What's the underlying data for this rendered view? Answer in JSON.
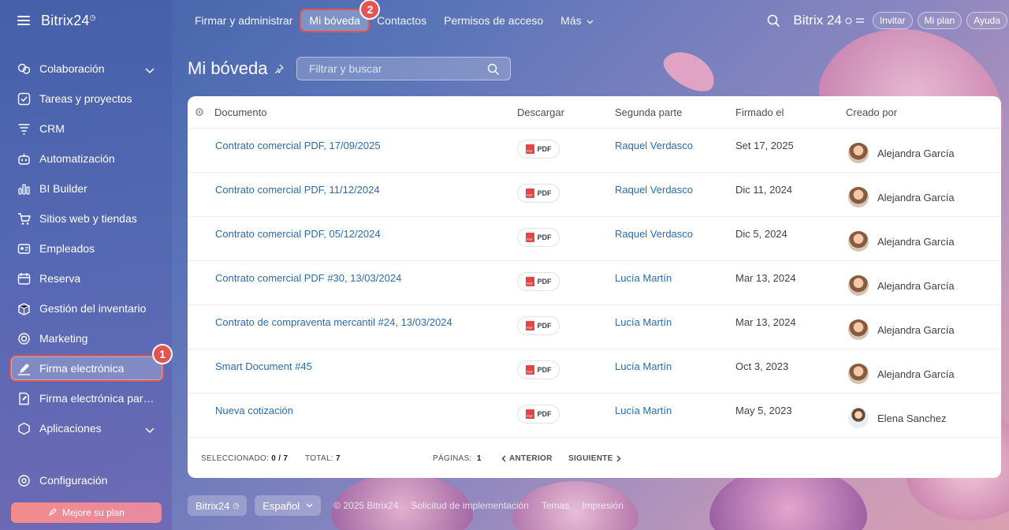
{
  "sidebar": {
    "brand": "Bitrix24",
    "items": [
      {
        "label": "Colaboración",
        "icon": "chat-bubbles-icon",
        "chevron": true
      },
      {
        "label": "Tareas y proyectos",
        "icon": "checkbox-icon"
      },
      {
        "label": "CRM",
        "icon": "funnel-icon"
      },
      {
        "label": "Automatización",
        "icon": "robot-icon"
      },
      {
        "label": "BI Builder",
        "icon": "bar-chart-icon"
      },
      {
        "label": "Sitios web y tiendas",
        "icon": "cart-icon"
      },
      {
        "label": "Empleados",
        "icon": "id-card-icon"
      },
      {
        "label": "Reserva",
        "icon": "calendar-icon"
      },
      {
        "label": "Gestión del inventario",
        "icon": "box-icon"
      },
      {
        "label": "Marketing",
        "icon": "target-icon"
      },
      {
        "label": "Firma electrónica",
        "icon": "pen-icon",
        "active": true,
        "badge": "1"
      },
      {
        "label": "Firma electrónica para RR.HH.",
        "icon": "pen-doc-icon"
      },
      {
        "label": "Aplicaciones",
        "icon": "grid-icon",
        "chevron": true
      }
    ],
    "config_label": "Configuración",
    "upgrade_label": "Mejore su plan"
  },
  "topnav": {
    "items": [
      "Firmar y administrar",
      "Mi bóveda",
      "Contactos",
      "Permisos de acceso",
      "Más"
    ],
    "active_badge": "2",
    "brand": "Bitrix 24",
    "pills": [
      "Invitar",
      "Mi plan",
      "Ayuda"
    ]
  },
  "page": {
    "title": "Mi bóveda",
    "search_placeholder": "Filtrar y buscar"
  },
  "table": {
    "headers": [
      "Documento",
      "Descargar",
      "Segunda parte",
      "Firmado el",
      "Creado por"
    ],
    "pdf_label": "PDF",
    "rows": [
      {
        "doc": "Contrato comercial PDF, 17/09/2025",
        "party": "Raquel Verdasco",
        "date": "Set 17, 2025",
        "author": "Alejandra García"
      },
      {
        "doc": "Contrato comercial PDF, 11/12/2024",
        "party": "Raquel Verdasco",
        "date": "Dic 11, 2024",
        "author": "Alejandra García"
      },
      {
        "doc": "Contrato comercial PDF, 05/12/2024",
        "party": "Raquel Verdasco",
        "date": "Dic 5, 2024",
        "author": "Alejandra García"
      },
      {
        "doc": "Contrato comercial PDF #30, 13/03/2024",
        "party": "Lucía Martín",
        "date": "Mar 13, 2024",
        "author": "Alejandra García"
      },
      {
        "doc": "Contrato de compraventa mercantil #24, 13/03/2024",
        "party": "Lucía Martín",
        "date": "Mar 13, 2024",
        "author": "Alejandra García"
      },
      {
        "doc": "Smart Document #45",
        "party": "Lucía Martín",
        "date": "Oct 3, 2023",
        "author": "Alejandra García"
      },
      {
        "doc": "Nueva cotización",
        "party": "Lucía Martín",
        "date": "May 5, 2023",
        "author": "Elena Sanchez"
      }
    ],
    "footer": {
      "selected_label": "SELECCIONADO:",
      "selected_value": "0 / 7",
      "total_label": "TOTAL:",
      "total_value": "7",
      "pages_label": "PÁGINAS:",
      "pages_value": "1",
      "prev": "ANTERIOR",
      "next": "SIGUIENTE"
    }
  },
  "bottom": {
    "brand": "Bitrix24",
    "language": "Español",
    "links": [
      "© 2025 Bitrix24",
      "Solicitud de implementación",
      "Temas",
      "Impresión"
    ]
  },
  "colors": {
    "accent_red": "#e0564f",
    "link_blue": "#2a6bb1"
  }
}
